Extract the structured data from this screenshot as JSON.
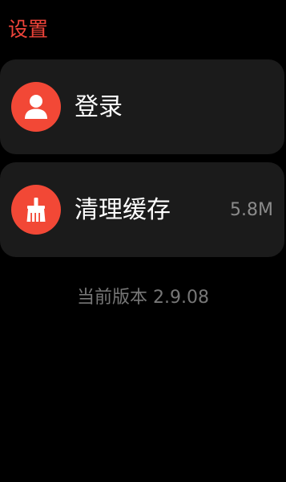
{
  "header": {
    "title": "设置"
  },
  "items": [
    {
      "label": "登录",
      "value": "",
      "icon": "person-icon"
    },
    {
      "label": "清理缓存",
      "value": "5.8M",
      "icon": "broom-icon"
    }
  ],
  "footer": {
    "version_text": "当前版本 2.9.08"
  },
  "colors": {
    "accent": "#f24836",
    "title": "#f0443a",
    "card_bg": "#1b1b1b",
    "background": "#000000",
    "secondary_text": "#8a8a8a"
  }
}
